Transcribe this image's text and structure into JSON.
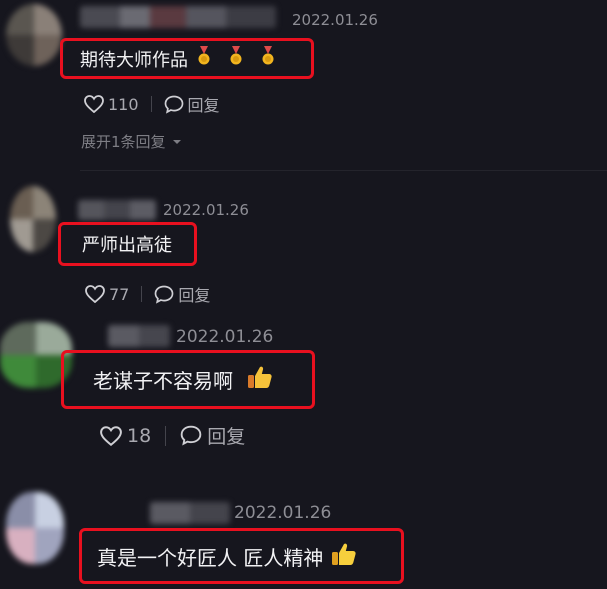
{
  "comments": [
    {
      "date": "2022.01.26",
      "text": "期待大师作品",
      "emojis": [
        "medal-icon",
        "medal-icon",
        "medal-icon"
      ],
      "likes": "110",
      "reply_label": "回复",
      "expand_label": "展开1条回复"
    },
    {
      "date": "2022.01.26",
      "text": "严师出高徒",
      "likes": "77",
      "reply_label": "回复"
    },
    {
      "date": "2022.01.26",
      "text": "老谋子不容易啊",
      "emoji": "thumbs-up-icon",
      "likes": "18",
      "reply_label": "回复"
    },
    {
      "date": "2022.01.26",
      "text": "真是一个好匠人 匠人精神",
      "emoji": "thumbs-up-icon"
    }
  ],
  "colors": {
    "background": "#16161e",
    "highlight": "#e8101f",
    "meta_text": "#8e8e95",
    "action_text": "#a9a9b0"
  }
}
